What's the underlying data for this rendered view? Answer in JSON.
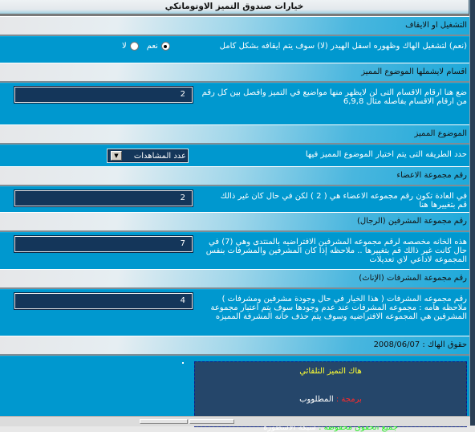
{
  "title": "خيارات صندوق التميز الاوتوماتكي",
  "sections": [
    {
      "header": "التشغيل او الايقاف",
      "description": "(نعم) لتشغيل الهاك وظهوره اسفل الهيدر (لا) سوف يتم ايقافه بشكل كامل",
      "control": "radio",
      "options": [
        {
          "label": "نعم",
          "checked": true
        },
        {
          "label": "لا",
          "checked": false
        }
      ]
    },
    {
      "header": "اقسام لايشملها الموضوع المميز",
      "description": "ضع هنا ارقام الاقسام التى لن لايظهر منها مواضيع في التميز وافصل بين كل رقم من ارقام الاقسام بفاصله مثال 6,9,8",
      "control": "text",
      "value": "2"
    },
    {
      "header": "الموضوع المميز",
      "description": "حدد الطريقه التى يتم اختيار الموضوع المميز فيها",
      "control": "select",
      "selected": "عدد المشاهدات"
    },
    {
      "header": "رقم مجموعة الاعضاء",
      "description": "في العادة تكون رقم مجموعه الاعضاء هي ( 2 ) لكن في حال كان غير ذالك قم بتغييرها هنا",
      "control": "text",
      "value": "2"
    },
    {
      "header": "رقم مجموعة المشرفين (الرجال)",
      "description": "هذه الخانه مخصصه لرقم مجموعه المشرفين الافتراضيه بالمنتدى وهي (7) في حال كانت غير ذالك قم بتغييرها .. ملاحظه إذا كان المشرفين والمشرفات بنفس المجموعه لاداعي لاي تعديلات",
      "control": "text",
      "value": "7"
    },
    {
      "header": "رقم مجموعة المشرفات (الإناث)",
      "description": "رقم مجموعه المشرفات ( هذا الخيار في حال وجودة مشرفين ومشرفات ) ملاحظه هامه : مجموعه المشرفات عند عدم وجودها سوف يتم اعتبار مجموعة المشرفين هي المجموعه الافتراضيه وسوف يتم حذف خانه المشرفة المميزه",
      "control": "text",
      "value": "4"
    }
  ],
  "rights_header": "حقوق الهاك : 2008/06/07",
  "credits": {
    "line1": "هاك التميز التلقائي",
    "line2_label": "برمجة :",
    "line2_value": "المطلووب",
    "line3_label": "جميع الحقوق محفوظة :",
    "line3_value": "شبكة الاسطوره"
  }
}
